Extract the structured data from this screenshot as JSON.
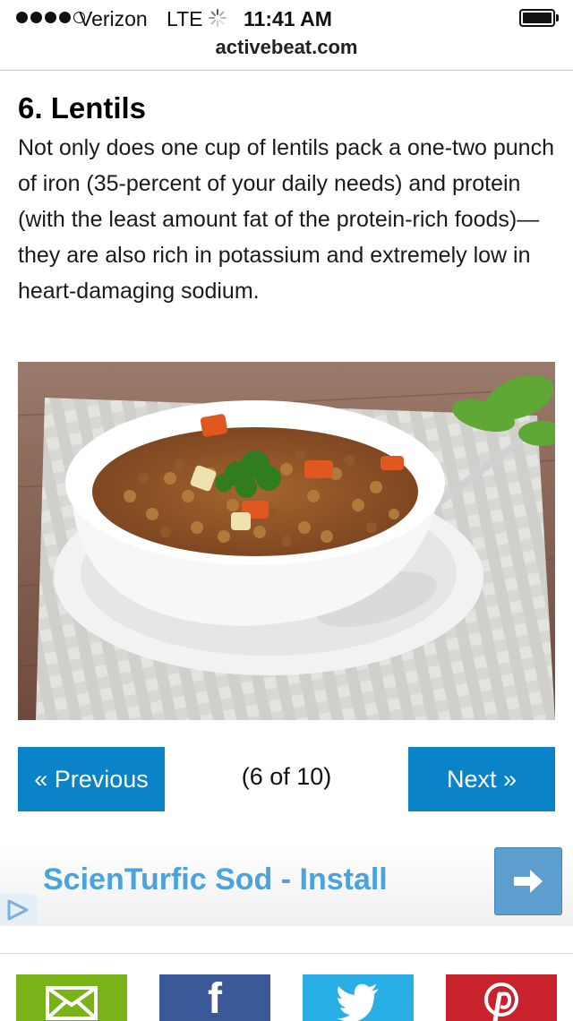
{
  "status_bar": {
    "carrier": "Verizon",
    "network": "LTE",
    "time": "11:41 AM",
    "signal_bars": 4,
    "signal_max": 5,
    "battery_level": 1.0
  },
  "address_bar": {
    "url": "activebeat.com"
  },
  "article": {
    "title": "6. Lentils",
    "body": "Not only does one cup of lentils pack a one-two punch of iron (35-percent of your daily needs) and protein (with the least amount fat of the protein-rich foods)—they are also rich in potassium and extremely low in heart-damaging sodium."
  },
  "pagination": {
    "previous_label": "« Previous",
    "indicator": "(6 of 10)",
    "next_label": "Next »"
  },
  "ad": {
    "text": "ScienTurfic Sod - Install",
    "arrow_icon": "arrow-right-icon",
    "choices_icon": "adchoices-icon"
  },
  "share_bar": {
    "items": [
      {
        "icon": "email-icon",
        "color": "#7ab317"
      },
      {
        "icon": "facebook-icon",
        "color": "#3b5998"
      },
      {
        "icon": "twitter-icon",
        "color": "#29aee5"
      },
      {
        "icon": "pinterest-icon",
        "color": "#c8232c"
      }
    ]
  },
  "colors": {
    "button_blue": "#0a83c9",
    "ad_text": "#4aa3dc",
    "ad_arrow_bg": "#5c9fcf"
  }
}
